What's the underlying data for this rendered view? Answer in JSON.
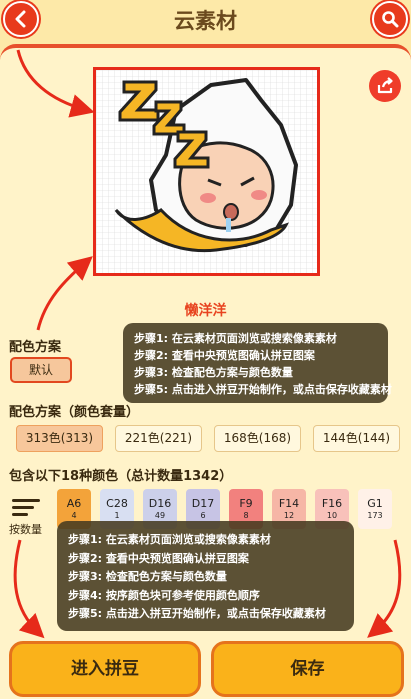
{
  "header": {
    "title": "云素材"
  },
  "material": {
    "name": "懒洋洋"
  },
  "color_scheme_section": {
    "label": "配色方案",
    "default_label": "默认"
  },
  "schemes_section": {
    "label": "配色方案（颜色套量）",
    "options": [
      "313色(313)",
      "221色(221)",
      "168色(168)",
      "144色(144)"
    ]
  },
  "summary": {
    "text": "包含以下18种颜色（总计数量1342）"
  },
  "sort": {
    "label": "按数量"
  },
  "palette": [
    {
      "code": "A6",
      "count": "4",
      "color": "#f3a33a"
    },
    {
      "code": "C28",
      "count": "1",
      "color": "#d8dff2"
    },
    {
      "code": "D16",
      "count": "49",
      "color": "#ccd0ea"
    },
    {
      "code": "D17",
      "count": "6",
      "color": "#c7c4e5"
    },
    {
      "code": "F9",
      "count": "8",
      "color": "#f2817e"
    },
    {
      "code": "F14",
      "count": "12",
      "color": "#f6b6a6"
    },
    {
      "code": "F16",
      "count": "10",
      "color": "#f8c1ba"
    },
    {
      "code": "G1",
      "count": "173",
      "color": "#fff1e8"
    }
  ],
  "tooltip_small": {
    "lines": [
      "步骤1: 在云素材页面浏览或搜索像素素材",
      "步骤2: 查看中央预览图确认拼豆图案",
      "步骤3: 检查配色方案与颜色数量",
      "步骤5: 点击进入拼豆开始制作，或点击保存收藏素材"
    ]
  },
  "tooltip_large": {
    "lines": [
      "步骤1: 在云素材页面浏览或搜索像素素材",
      "步骤2: 查看中央预览图确认拼豆图案",
      "步骤3: 检查配色方案与颜色数量",
      "步骤4: 按序颜色块可参考使用颜色顺序",
      "步骤5: 点击进入拼豆开始制作，或点击保存收藏素材"
    ]
  },
  "actions": {
    "enter_label": "进入拼豆",
    "save_label": "保存"
  },
  "icons": {
    "back": "back-arrow-icon",
    "search": "search-icon",
    "share": "share-icon",
    "sort": "sort-lines-icon"
  },
  "colors": {
    "accent": "#e83a1c",
    "button": "#fab21a",
    "panel": "#fff3c9",
    "background": "#fde9a8",
    "name_text": "#e8431f"
  }
}
